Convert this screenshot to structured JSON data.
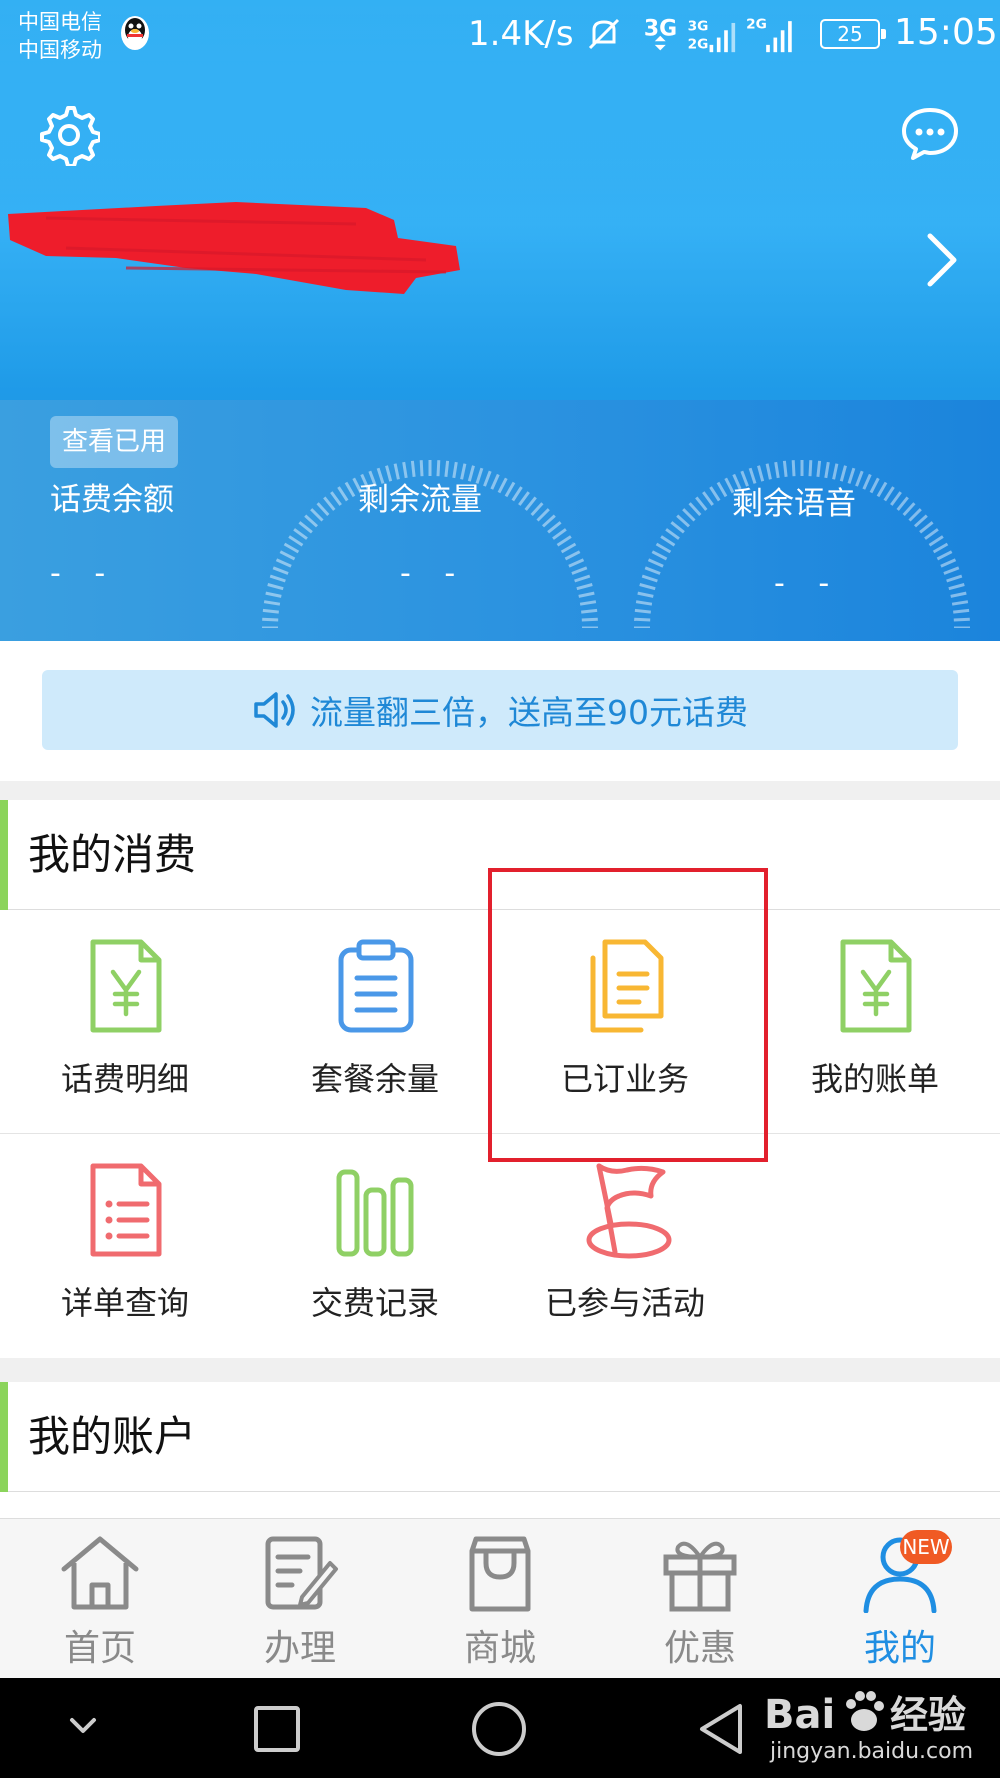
{
  "status_bar": {
    "carrier_1": "中国电信",
    "carrier_2": "中国移动",
    "net_speed": "1.4K/s",
    "signal_3g": "3G",
    "signal_3g_2g_top": "3G",
    "signal_3g_2g_bottom": "2G",
    "signal_2g": "2G",
    "battery": "25",
    "time": "15:05"
  },
  "header": {
    "used_badge": "查看已用",
    "balance_label": "话费余额",
    "balance_value": "- -",
    "data_label": "剩余流量",
    "data_value": "- -",
    "voice_label": "剩余语音",
    "voice_value": "- -"
  },
  "promo": {
    "text": "流量翻三倍，送高至90元话费"
  },
  "consumption": {
    "title": "我的消费",
    "row1": [
      {
        "label": "话费明细",
        "icon": "yuan-document-icon"
      },
      {
        "label": "套餐余量",
        "icon": "clipboard-icon"
      },
      {
        "label": "已订业务",
        "icon": "documents-icon"
      },
      {
        "label": "我的账单",
        "icon": "yuan-document-icon"
      }
    ],
    "row2": [
      {
        "label": "详单查询",
        "icon": "list-document-icon"
      },
      {
        "label": "交费记录",
        "icon": "bar-chart-icon"
      },
      {
        "label": "已参与活动",
        "icon": "flag-icon"
      }
    ]
  },
  "account": {
    "title": "我的账户"
  },
  "tabs": [
    {
      "label": "首页",
      "icon": "home-icon"
    },
    {
      "label": "办理",
      "icon": "edit-document-icon"
    },
    {
      "label": "商城",
      "icon": "shopping-bag-icon"
    },
    {
      "label": "优惠",
      "icon": "gift-icon"
    },
    {
      "label": "我的",
      "icon": "user-icon",
      "active": true,
      "badge": "NEW"
    }
  ],
  "watermark": {
    "brand_a": "Bai",
    "brand_b": "经验",
    "url": "jingyan.baidu.com"
  },
  "colors": {
    "header_blue": "#22a9f2",
    "accent_green": "#8bd45b",
    "icon_green": "#8fd065",
    "icon_blue": "#4a98e8",
    "icon_orange": "#f8b733",
    "icon_red": "#f06b6f",
    "tab_active": "#1f8ee2",
    "highlight_red": "#e2202d"
  }
}
